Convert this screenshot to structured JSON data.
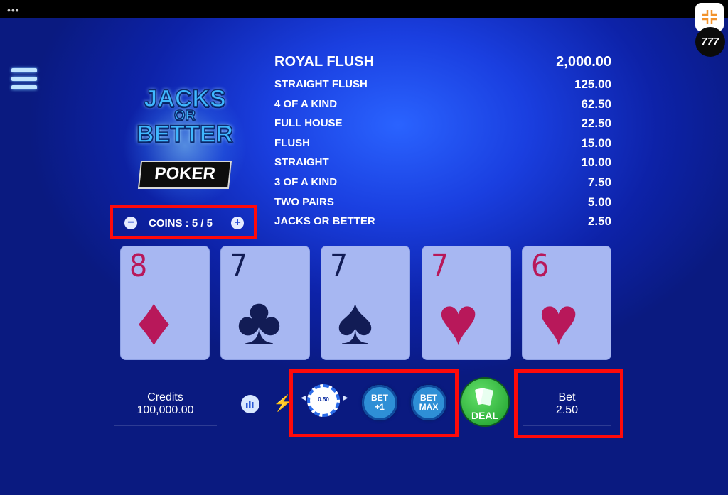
{
  "window": {
    "dots": "•••"
  },
  "logo": {
    "line1": "JACKS",
    "line2": "OR",
    "line3": "BETTER",
    "poker": "POKER"
  },
  "corner": {
    "badge": "777"
  },
  "paytable": [
    {
      "hand": "ROYAL FLUSH",
      "payout": "2,000.00"
    },
    {
      "hand": "STRAIGHT FLUSH",
      "payout": "125.00"
    },
    {
      "hand": "4 OF A KIND",
      "payout": "62.50"
    },
    {
      "hand": "FULL HOUSE",
      "payout": "22.50"
    },
    {
      "hand": "FLUSH",
      "payout": "15.00"
    },
    {
      "hand": "STRAIGHT",
      "payout": "10.00"
    },
    {
      "hand": "3 OF A KIND",
      "payout": "7.50"
    },
    {
      "hand": "TWO PAIRS",
      "payout": "5.00"
    },
    {
      "hand": "JACKS OR BETTER",
      "payout": "2.50"
    }
  ],
  "coins": {
    "label": "COINS : 5 / 5",
    "minus": "−",
    "plus": "+"
  },
  "cards": [
    {
      "rank": "8",
      "suit": "♦",
      "color": "#b8185a"
    },
    {
      "rank": "7",
      "suit": "♣",
      "color": "#121c55"
    },
    {
      "rank": "7",
      "suit": "♠",
      "color": "#121c55"
    },
    {
      "rank": "7",
      "suit": "♥",
      "color": "#b8185a"
    },
    {
      "rank": "6",
      "suit": "♥",
      "color": "#b8185a"
    }
  ],
  "credits": {
    "label": "Credits",
    "value": "100,000.00"
  },
  "chip": {
    "value": "0.50"
  },
  "buttons": {
    "bet_plus_1": "BET\n+1",
    "bet_max": "BET\nMAX",
    "deal": "DEAL"
  },
  "bet": {
    "label": "Bet",
    "value": "2.50"
  },
  "colors": {
    "highlight_box": "#ff0a0a",
    "background": "#1a3fe0",
    "deal": "#1a9c29"
  }
}
